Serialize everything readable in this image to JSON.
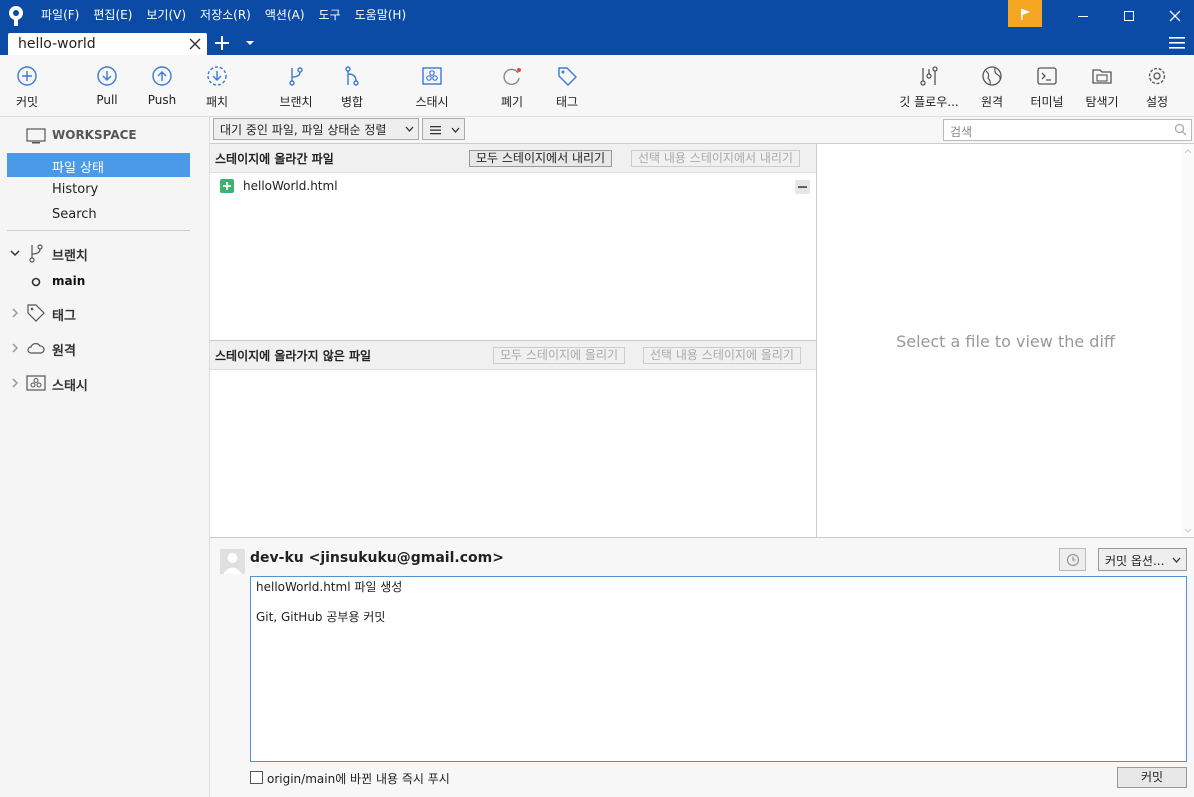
{
  "menu": [
    "파일(F)",
    "편집(E)",
    "보기(V)",
    "저장소(R)",
    "액션(A)",
    "도구",
    "도움말(H)"
  ],
  "tab": {
    "label": "hello-world"
  },
  "toolbar": {
    "commit": "커밋",
    "pull": "Pull",
    "push": "Push",
    "fetch": "패치",
    "branch": "브랜치",
    "merge": "병합",
    "stash": "스태시",
    "discard": "폐기",
    "tag": "태그",
    "gitflow": "깃 플로우...",
    "remote": "원격",
    "terminal": "터미널",
    "explorer": "탐색기",
    "settings": "설정"
  },
  "sidebar": {
    "workspace": "WORKSPACE",
    "items": [
      "파일 상태",
      "History",
      "Search"
    ],
    "branches": "브랜치",
    "branch_main": "main",
    "tags": "태그",
    "remotes": "원격",
    "stashes": "스태시"
  },
  "filter": {
    "sort": "대기 중인 파일, 파일 상태순 정렬",
    "search_placeholder": "검색"
  },
  "staged": {
    "title": "스테이지에 올라간 파일",
    "unstage_all": "모두 스테이지에서 내리기",
    "unstage_selected": "선택 내용 스테이지에서 내리기",
    "files": [
      "helloWorld.html"
    ]
  },
  "unstaged": {
    "title": "스테이지에 올라가지 않은 파일",
    "stage_all": "모두 스테이지에 올리기",
    "stage_selected": "선택 내용 스테이지에 올리기"
  },
  "diff": {
    "placeholder": "Select a file to view the diff"
  },
  "commit": {
    "author": "dev-ku <jinsukuku@gmail.com>",
    "options": "커밋 옵션...",
    "message_lines": [
      "helloWorld.html 파일 생성",
      "",
      "Git, GitHub 공부용 커밋"
    ],
    "push_option": "origin/main에 바뀐 내용 즉시 푸시",
    "button": "커밋"
  },
  "colors": {
    "titlebar": "#0b4aa5",
    "accent": "#4a9ae8",
    "flag": "#f5a623",
    "added": "#3cb371"
  }
}
